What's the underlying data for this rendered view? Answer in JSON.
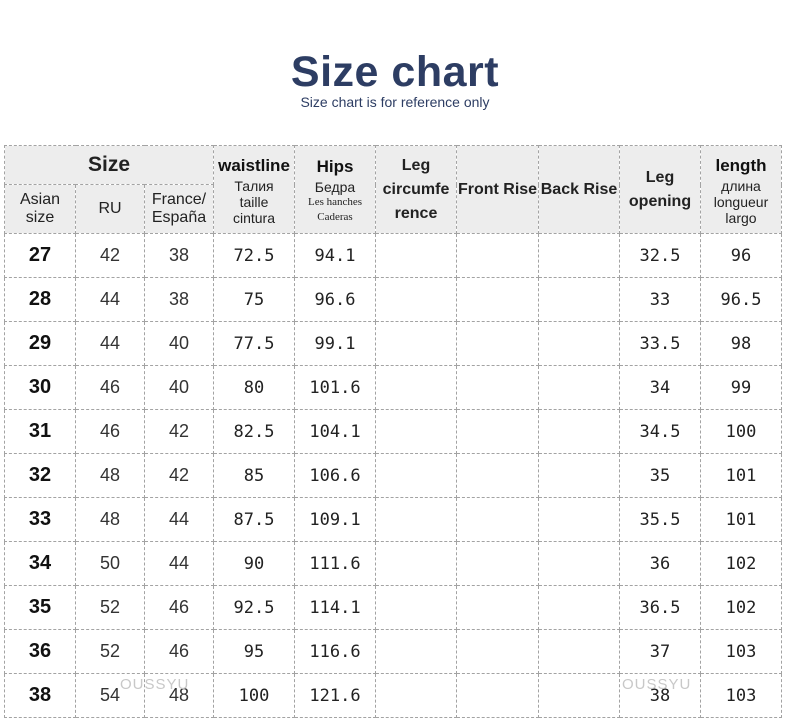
{
  "title": "Size chart",
  "subtitle": "Size chart is for reference only",
  "headers": {
    "size": "Size",
    "asian_size": "Asian size",
    "ru": "RU",
    "france": "France/ España",
    "waistline": {
      "en": "waistline",
      "ru": "Талия",
      "fr": "taille",
      "es": "cintura"
    },
    "hips": {
      "en": "Hips",
      "ru": "Бедра",
      "fr": "Les hanches",
      "es": "Caderas"
    },
    "leg_circumference": "Leg circumfe rence",
    "front_rise": "Front Rise",
    "back_rise": "Back Rise",
    "leg_opening": "Leg opening",
    "length": {
      "en": "length",
      "ru": "длина",
      "fr": "longueur",
      "es": "largo"
    }
  },
  "watermark": "OUSSYU",
  "rows": [
    {
      "size": "27",
      "ru": "42",
      "fr": "38",
      "waist": "72.5",
      "hips": "94.1",
      "leg_circ": "",
      "front_rise": "",
      "back_rise": "",
      "leg_opening": "32.5",
      "length": "96"
    },
    {
      "size": "28",
      "ru": "44",
      "fr": "38",
      "waist": "75",
      "hips": "96.6",
      "leg_circ": "",
      "front_rise": "",
      "back_rise": "",
      "leg_opening": "33",
      "length": "96.5"
    },
    {
      "size": "29",
      "ru": "44",
      "fr": "40",
      "waist": "77.5",
      "hips": "99.1",
      "leg_circ": "",
      "front_rise": "",
      "back_rise": "",
      "leg_opening": "33.5",
      "length": "98"
    },
    {
      "size": "30",
      "ru": "46",
      "fr": "40",
      "waist": "80",
      "hips": "101.6",
      "leg_circ": "",
      "front_rise": "",
      "back_rise": "",
      "leg_opening": "34",
      "length": "99"
    },
    {
      "size": "31",
      "ru": "46",
      "fr": "42",
      "waist": "82.5",
      "hips": "104.1",
      "leg_circ": "",
      "front_rise": "",
      "back_rise": "",
      "leg_opening": "34.5",
      "length": "100"
    },
    {
      "size": "32",
      "ru": "48",
      "fr": "42",
      "waist": "85",
      "hips": "106.6",
      "leg_circ": "",
      "front_rise": "",
      "back_rise": "",
      "leg_opening": "35",
      "length": "101"
    },
    {
      "size": "33",
      "ru": "48",
      "fr": "44",
      "waist": "87.5",
      "hips": "109.1",
      "leg_circ": "",
      "front_rise": "",
      "back_rise": "",
      "leg_opening": "35.5",
      "length": "101"
    },
    {
      "size": "34",
      "ru": "50",
      "fr": "44",
      "waist": "90",
      "hips": "111.6",
      "leg_circ": "",
      "front_rise": "",
      "back_rise": "",
      "leg_opening": "36",
      "length": "102"
    },
    {
      "size": "35",
      "ru": "52",
      "fr": "46",
      "waist": "92.5",
      "hips": "114.1",
      "leg_circ": "",
      "front_rise": "",
      "back_rise": "",
      "leg_opening": "36.5",
      "length": "102"
    },
    {
      "size": "36",
      "ru": "52",
      "fr": "46",
      "waist": "95",
      "hips": "116.6",
      "leg_circ": "",
      "front_rise": "",
      "back_rise": "",
      "leg_opening": "37",
      "length": "103"
    },
    {
      "size": "38",
      "ru": "54",
      "fr": "48",
      "waist": "100",
      "hips": "121.6",
      "leg_circ": "",
      "front_rise": "",
      "back_rise": "",
      "leg_opening": "38",
      "length": "103"
    }
  ]
}
